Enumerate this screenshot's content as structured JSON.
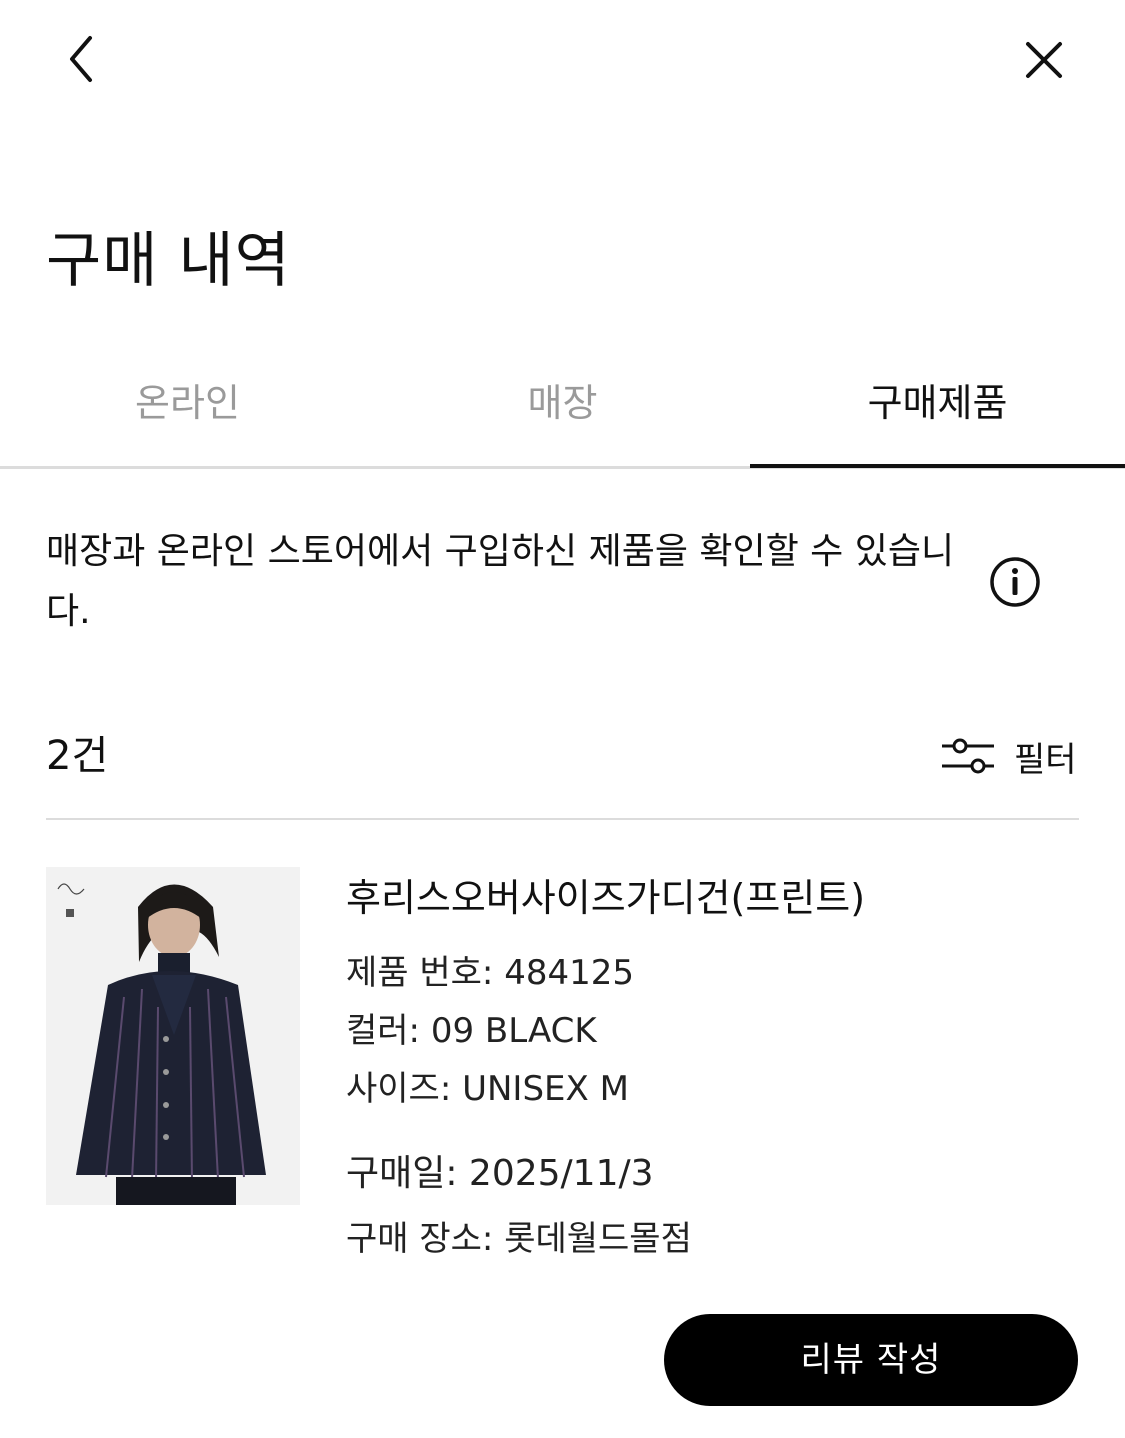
{
  "header": {
    "back_icon": "chevron-left-icon",
    "close_icon": "close-icon",
    "title": "구매 내역"
  },
  "tabs": [
    {
      "label": "온라인",
      "active": false
    },
    {
      "label": "매장",
      "active": false
    },
    {
      "label": "구매제품",
      "active": true
    }
  ],
  "notice": {
    "text": "매장과 온라인 스토어에서 구입하신 제품을 확인할 수 있습니다.",
    "info_icon": "info-icon"
  },
  "list": {
    "count": "2건",
    "filter_label": "필터",
    "filter_icon": "sliders-icon"
  },
  "products": [
    {
      "name": "후리스오버사이즈가디건(프린트)",
      "number": "제품 번호: 484125",
      "color": "컬러: 09 BLACK",
      "size": "사이즈: UNISEX M",
      "purchase_date": "구매일: 2025/11/3",
      "purchase_place": "구매 장소: 롯데월드몰점",
      "review_button": "리뷰 작성"
    }
  ],
  "colors": {
    "accent": "#000000",
    "inactive_tab": "#9a9a9a",
    "divider": "#dcdcdc"
  }
}
